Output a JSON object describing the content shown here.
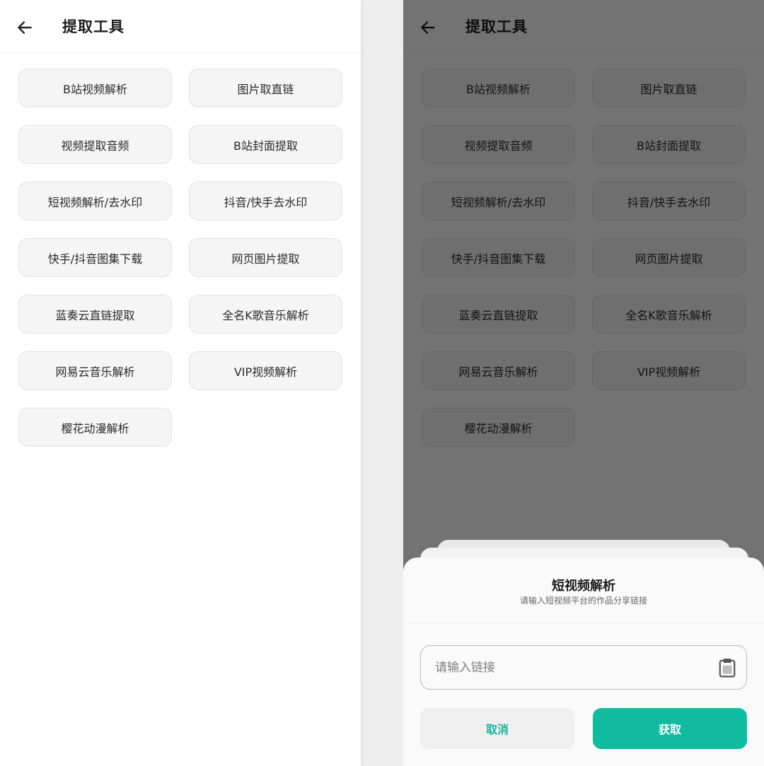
{
  "app": {
    "title": "提取工具",
    "colors": {
      "accent": "#10bb9f",
      "button_background": "#f5f5f5",
      "button_border": "#e3e3e3",
      "overlay": "rgba(0,0,0,0.55)"
    }
  },
  "header": {
    "back_icon": "arrow-left-icon",
    "title": "提取工具"
  },
  "tools": [
    {
      "label": "B站视频解析"
    },
    {
      "label": "图片取直链"
    },
    {
      "label": "视频提取音频"
    },
    {
      "label": "B站封面提取"
    },
    {
      "label": "短视频解析/去水印"
    },
    {
      "label": "抖音/快手去水印"
    },
    {
      "label": "快手/抖音图集下载"
    },
    {
      "label": "网页图片提取"
    },
    {
      "label": "蓝奏云直链提取"
    },
    {
      "label": "全名K歌音乐解析"
    },
    {
      "label": "网易云音乐解析"
    },
    {
      "label": "VIP视频解析"
    },
    {
      "label": "樱花动漫解析"
    }
  ],
  "dialog": {
    "title": "短视频解析",
    "subtitle": "请输入短视频平台的作品分享链接",
    "input_value": "",
    "input_placeholder": "请输入链接",
    "paste_icon": "clipboard-icon",
    "cancel_label": "取消",
    "confirm_label": "获取"
  }
}
